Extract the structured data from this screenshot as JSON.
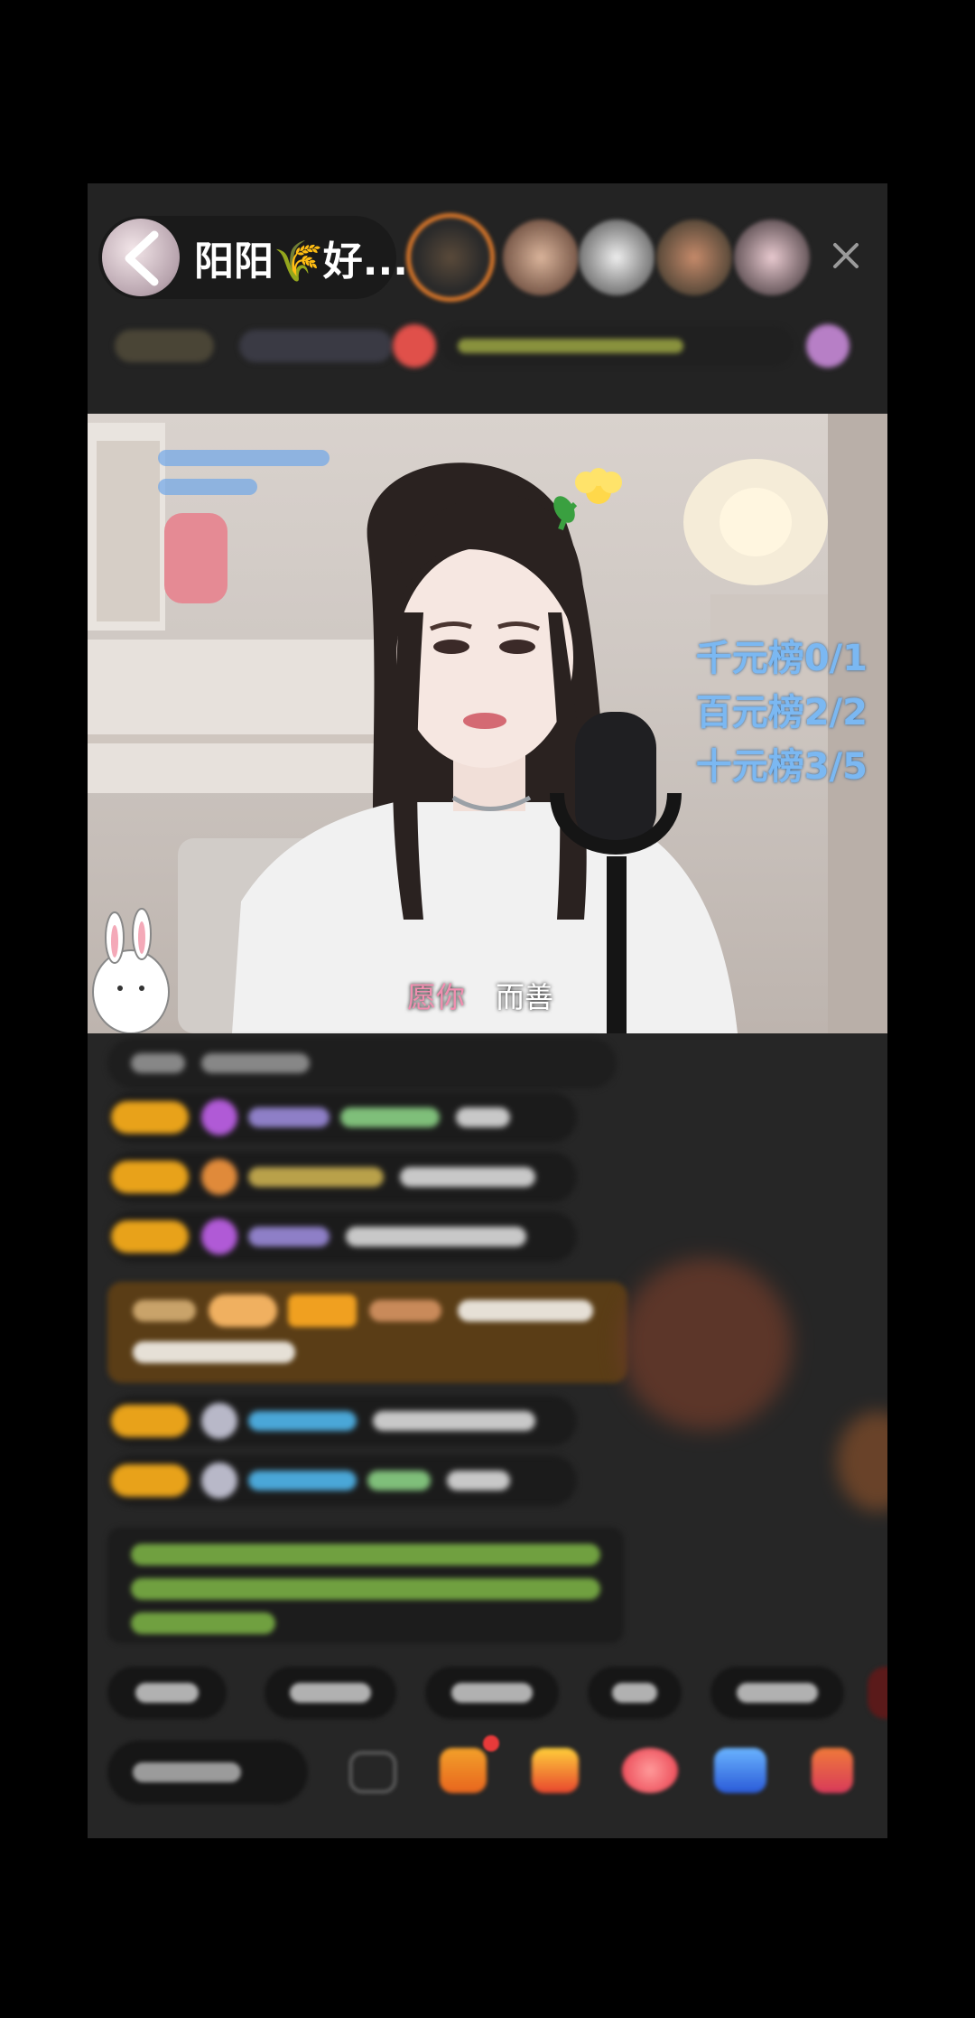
{
  "header": {
    "host_name": "阳阳🌾好...",
    "close_icon": "close-icon"
  },
  "video_overlay": {
    "rank_lines": [
      "千元榜0/1",
      "百元榜2/2",
      "十元榜3/5"
    ],
    "caption_pink": "愿你",
    "caption_rest": "而善"
  },
  "colors": {
    "background": "#000000",
    "panel": "#262626",
    "badge": "#e8a21a",
    "rank_text": "#7bb8f2",
    "system_text": "#86c24a"
  }
}
